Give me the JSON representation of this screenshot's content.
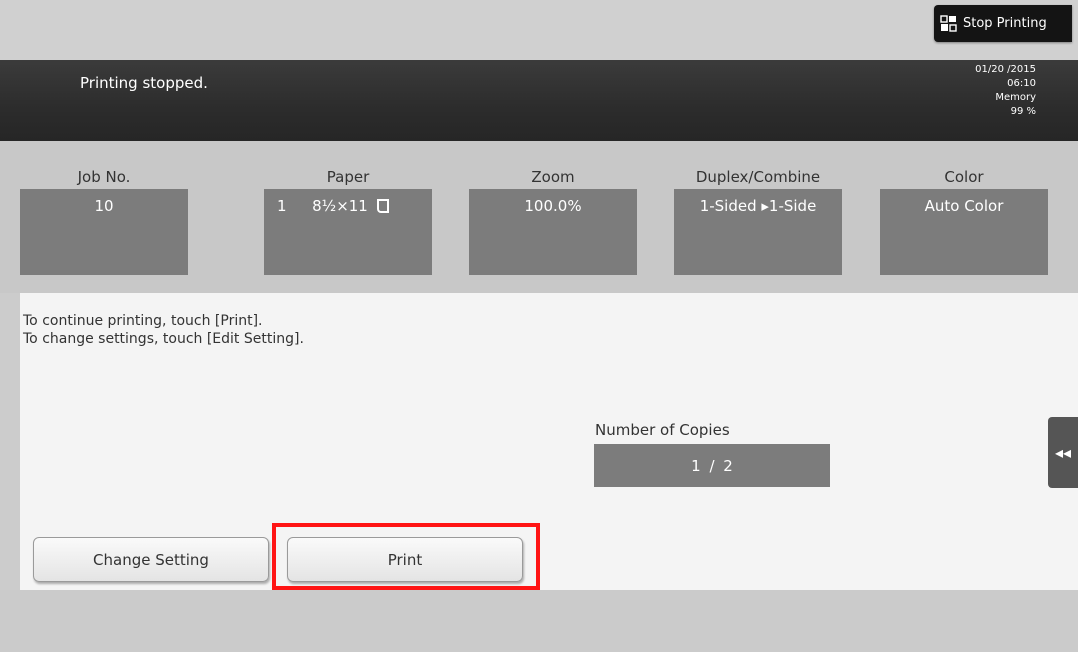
{
  "stop_button": {
    "label": "Stop Printing",
    "icon": "stop-printing-icon"
  },
  "status": {
    "message": "Printing stopped.",
    "date": "01/20 /2015",
    "time": "06:10",
    "memory_label": "Memory",
    "memory_value": "99 %"
  },
  "job_info": {
    "job_no": {
      "label": "Job No.",
      "value": "10"
    },
    "paper": {
      "label": "Paper",
      "tray": "1",
      "size": "8½×11",
      "icon": "paper-orientation-icon"
    },
    "zoom": {
      "label": "Zoom",
      "value": "100.0%"
    },
    "duplex": {
      "label": "Duplex/Combine",
      "value": "1-Sided ▸1-Side"
    },
    "color": {
      "label": "Color",
      "value": "Auto Color"
    }
  },
  "message_lines": [
    "To continue printing, touch [Print].",
    "To change settings, touch [Edit Setting]."
  ],
  "copies": {
    "label": "Number of Copies",
    "value": "1 / 2"
  },
  "side_tab": {
    "icon": "double-arrow-left-icon",
    "glyph": "◂◂"
  },
  "buttons": {
    "change_setting": "Change Setting",
    "print": "Print"
  },
  "colors": {
    "highlight": "#ff1414",
    "panel": "#7c7c7c",
    "status_bar": "#2c2c2c"
  }
}
